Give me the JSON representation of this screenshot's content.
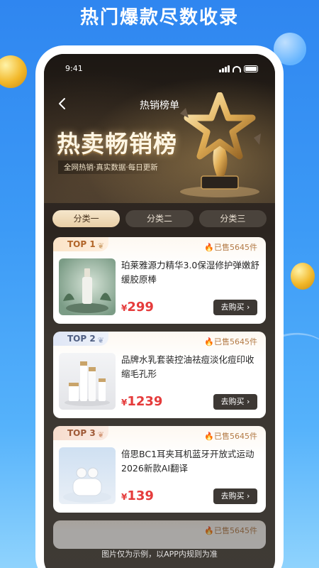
{
  "promo": {
    "title": "热门爆款尽数收录",
    "footer": "图片仅为示例，以APP内规则为准"
  },
  "status_bar": {
    "time": "9:41"
  },
  "nav": {
    "title": "热销榜单"
  },
  "hero": {
    "title": "热卖畅销榜",
    "subtitle": "全网热销·真实数据·每日更新"
  },
  "tabs": [
    {
      "label": "分类一",
      "active": true
    },
    {
      "label": "分类二",
      "active": false
    },
    {
      "label": "分类三",
      "active": false
    }
  ],
  "products": [
    {
      "rank": "TOP 1",
      "sold": "已售5645件",
      "name": "珀莱雅源力精华3.0保湿修护弹嫩舒缓胶原棒",
      "currency": "¥",
      "price": "299",
      "buy_label": "去购买"
    },
    {
      "rank": "TOP 2",
      "sold": "已售5645件",
      "name": "品牌水乳套装控油祛痘淡化痘印收缩毛孔形",
      "currency": "¥",
      "price": "1239",
      "buy_label": "去购买"
    },
    {
      "rank": "TOP 3",
      "sold": "已售5645件",
      "name": "倍思BC1耳夹耳机蓝牙开放式运动2026新款AI翻译",
      "currency": "¥",
      "price": "139",
      "buy_label": "去购买"
    },
    {
      "sold": "已售5645件"
    }
  ],
  "icons": {
    "back": "chevron-left-icon",
    "sold": "fire-icon",
    "buy": "chevron-right-icon",
    "trophy": "trophy-star-icon"
  },
  "colors": {
    "price": "#e53b3b",
    "accent_gold": "#e9cfa6",
    "background_blue": "#3c9af6"
  }
}
